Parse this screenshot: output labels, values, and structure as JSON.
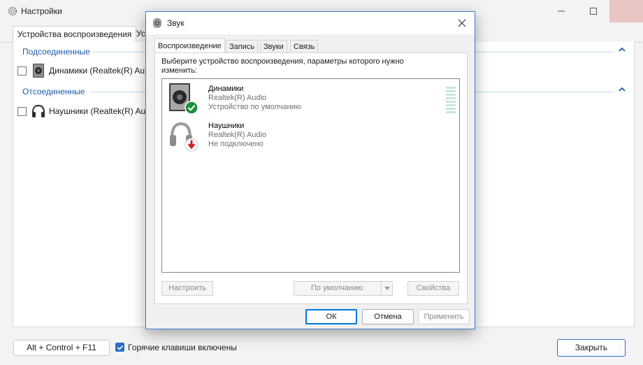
{
  "settings_window": {
    "title": "Настройки",
    "tabs": [
      {
        "label": "Устройства воспроизведения"
      },
      {
        "label": "Ус"
      }
    ],
    "groups": {
      "connected": {
        "label": "Подсоединенные",
        "devices": [
          {
            "label": "Динамики (Realtek(R) Au"
          }
        ]
      },
      "disconnected": {
        "label": "Отсоединенные",
        "devices": [
          {
            "label": "Наушники (Realtek(R) Au"
          }
        ]
      }
    },
    "bottom": {
      "hotkey_button": "Alt + Control + F11",
      "hotkey_checkbox_label": "Горячие клавиши включены",
      "hotkey_checked": true,
      "close_button": "Закрыть"
    }
  },
  "sound_dialog": {
    "title": "Звук",
    "tabs": [
      {
        "label": "Воспроизведение"
      },
      {
        "label": "Запись"
      },
      {
        "label": "Звуки"
      },
      {
        "label": "Связь"
      }
    ],
    "prompt": "Выберите устройство воспроизведения, параметры которого нужно изменить:",
    "devices": [
      {
        "name": "Динамики",
        "driver": "Realtek(R) Audio",
        "state": "Устройство по умолчанию",
        "icon": "speaker-icon",
        "badge": "checkmark-badge-icon"
      },
      {
        "name": "Наушники",
        "driver": "Realtek(R) Audio",
        "state": "Не подключено",
        "icon": "headphones-icon",
        "badge": "down-arrow-badge-icon"
      }
    ],
    "buttons": {
      "configure": "Настроить",
      "set_default": "По умолчанию",
      "properties": "Свойства",
      "ok": "ОК",
      "cancel": "Отмена",
      "apply": "Применить"
    }
  },
  "colors": {
    "accent": "#0078d7",
    "group_label": "#1e5aa8",
    "default_badge": "#1f8f3a",
    "disconnected_badge": "#d32020"
  }
}
